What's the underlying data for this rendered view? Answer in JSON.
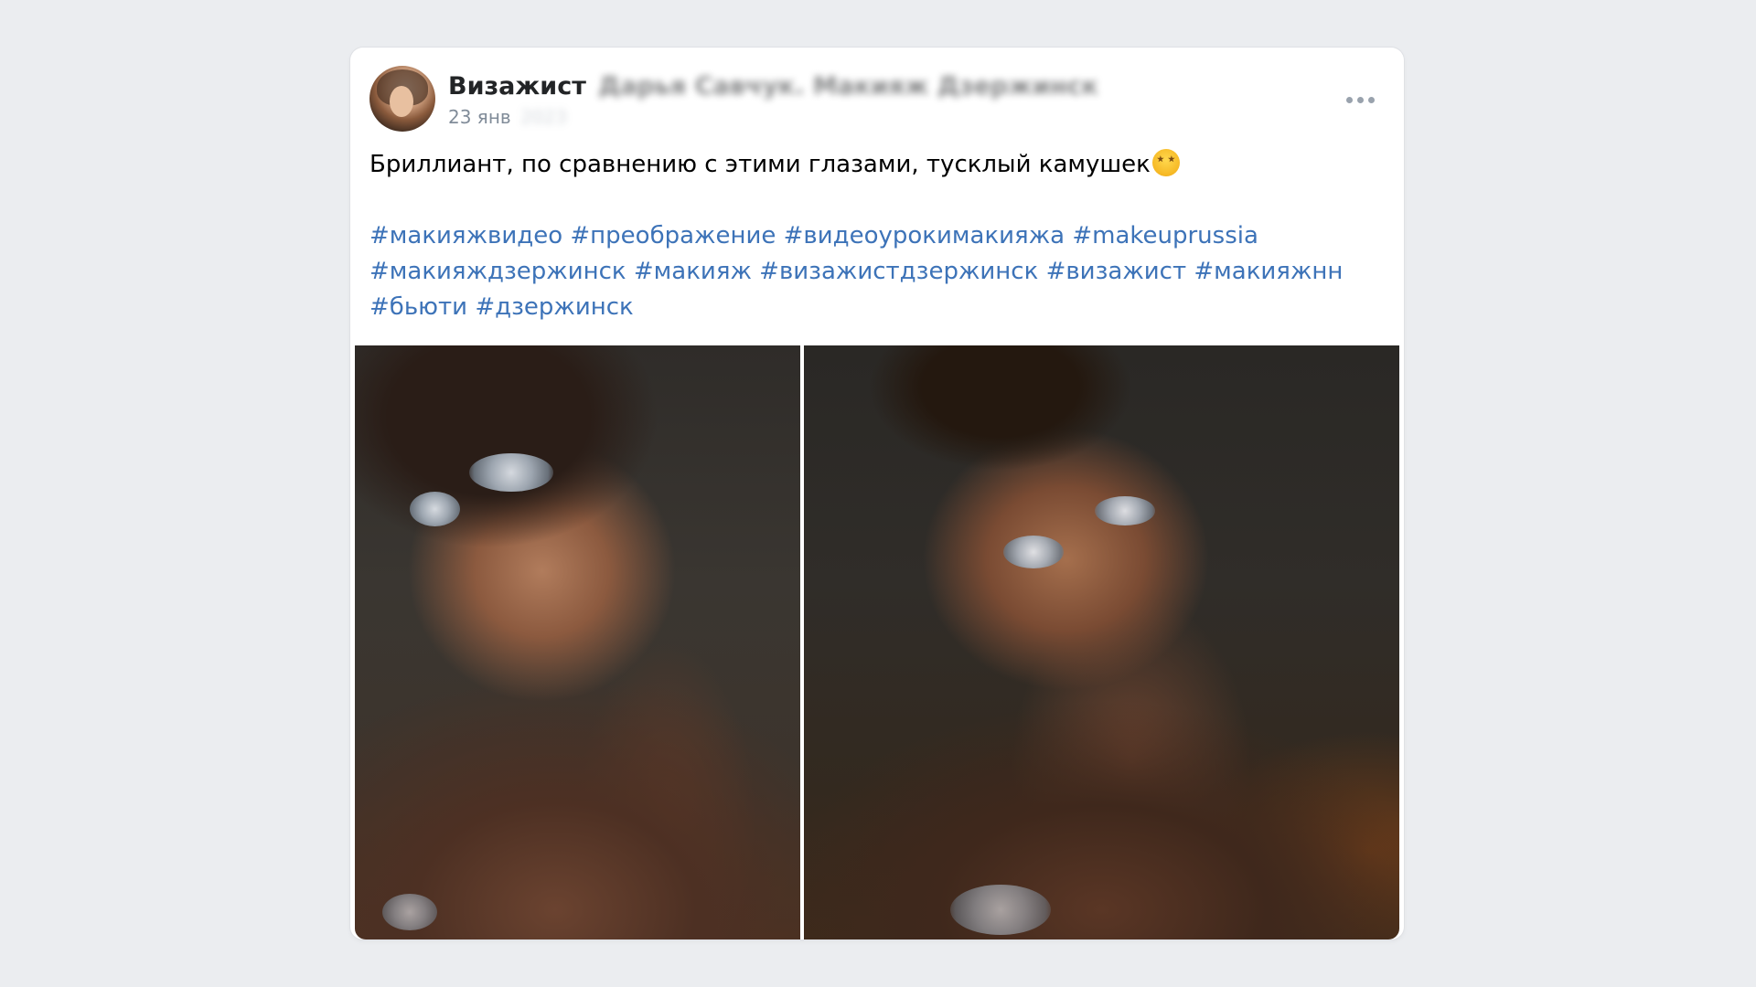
{
  "post": {
    "author_name": "Визажист",
    "author_name_blurred": "Дарья Савчук. Макияж Дзержинск",
    "date": "23 янв",
    "date_year_blurred": "2023",
    "text": "Бриллиант, по сравнению с этими глазами, тусклый камушек",
    "emoji": "star-struck-emoji",
    "hashtags": [
      "#макияжвидео",
      "#преображение",
      "#видеоурокимакияжа",
      "#makeuprussia",
      "#макияждзержинск",
      "#макияж",
      "#визажистдзержинск",
      "#визажист",
      "#макияжнн",
      "#бьюти",
      "#дзержинск"
    ],
    "photos": [
      {
        "name": "photo-1"
      },
      {
        "name": "photo-2"
      }
    ],
    "more_icon": "more-horizontal-icon",
    "colors": {
      "hashtag": "#3d73b8",
      "meta": "#818c99",
      "background": "#ebedf0"
    }
  }
}
